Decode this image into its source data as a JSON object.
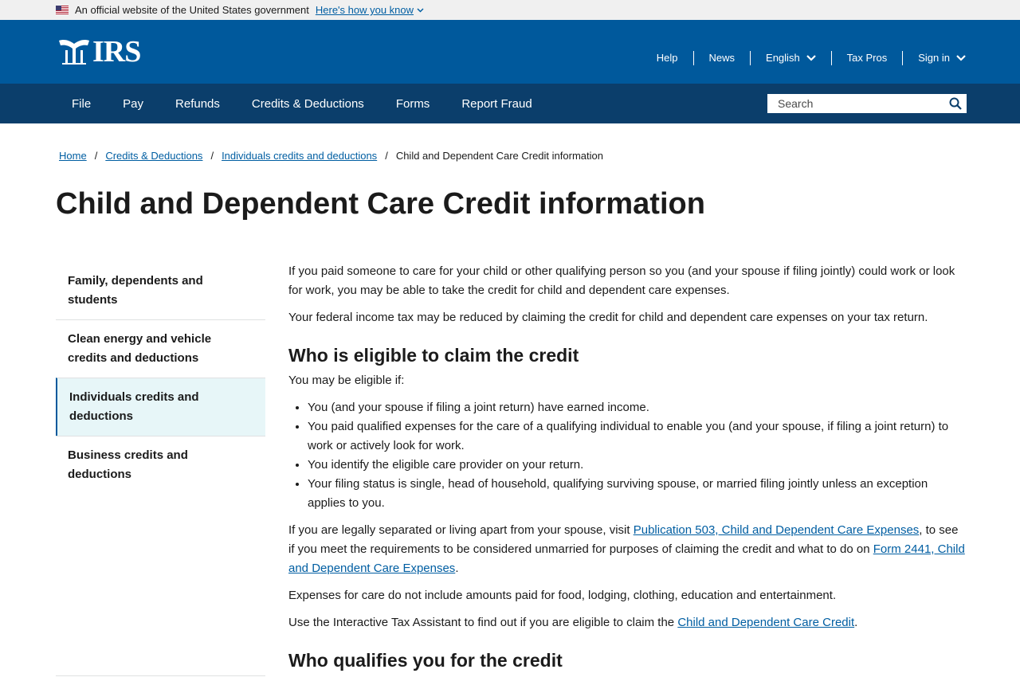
{
  "gov_banner": {
    "text": "An official website of the United States government",
    "link": "Here's how you know"
  },
  "header": {
    "logo_text": "IRS",
    "util_nav": [
      "Help",
      "News",
      "English",
      "Tax Pros",
      "Sign in"
    ]
  },
  "main_nav": {
    "items": [
      "File",
      "Pay",
      "Refunds",
      "Credits & Deductions",
      "Forms",
      "Report Fraud"
    ],
    "search_placeholder": "Search"
  },
  "breadcrumb": {
    "items": [
      "Home",
      "Credits & Deductions",
      "Individuals credits and deductions"
    ],
    "separator": "/",
    "current": "Child and Dependent Care Credit information"
  },
  "page_title": "Child and Dependent Care Credit information",
  "sidenav": {
    "items": [
      "Family, dependents and students",
      "Clean energy and vehicle credits and deductions",
      "Individuals credits and deductions",
      "Business credits and deductions"
    ],
    "active_index": 2
  },
  "content": {
    "p1": "If you paid someone to care for your child or other qualifying person so you (and your spouse if filing jointly) could work or look for work, you may be able to take the credit for child and dependent care expenses.",
    "p2": "Your federal income tax may be reduced by claiming the credit for child and dependent care expenses on your tax return.",
    "h2_eligible": "Who is eligible to claim the credit",
    "eligible_intro": "You may be eligible if:",
    "eligible_list": [
      "You (and your spouse if filing a joint return) have earned income.",
      "You paid qualified expenses for the care of a qualifying individual to enable you (and your spouse, if filing a joint return) to work or actively look for work.",
      "You identify the eligible care provider on your return.",
      "Your filing status is single, head of household, qualifying surviving spouse, or married filing jointly unless an exception applies to you."
    ],
    "separated_p": {
      "before": "If you are legally separated or living apart from your spouse, visit ",
      "link1": "Publication 503, Child and Dependent Care Expenses",
      "middle": ", to see if you meet the requirements to be considered unmarried for purposes of claiming the credit and what to do on ",
      "link2": "Form 2441, Child and Dependent Care Expenses",
      "after": "."
    },
    "expenses_p": "Expenses for care do not include amounts paid for food, lodging, clothing, education and entertainment.",
    "ita_p": {
      "before": "Use the Interactive Tax Assistant to find out if you are eligible to claim the ",
      "link": "Child and Dependent Care Credit",
      "after": "."
    },
    "h2_qualifies": "Who qualifies you for the credit"
  },
  "colors": {
    "header_blue": "#00599c",
    "nav_navy": "#0b3e6b",
    "link_blue": "#005ea2",
    "active_bg": "#e7f6f8"
  }
}
